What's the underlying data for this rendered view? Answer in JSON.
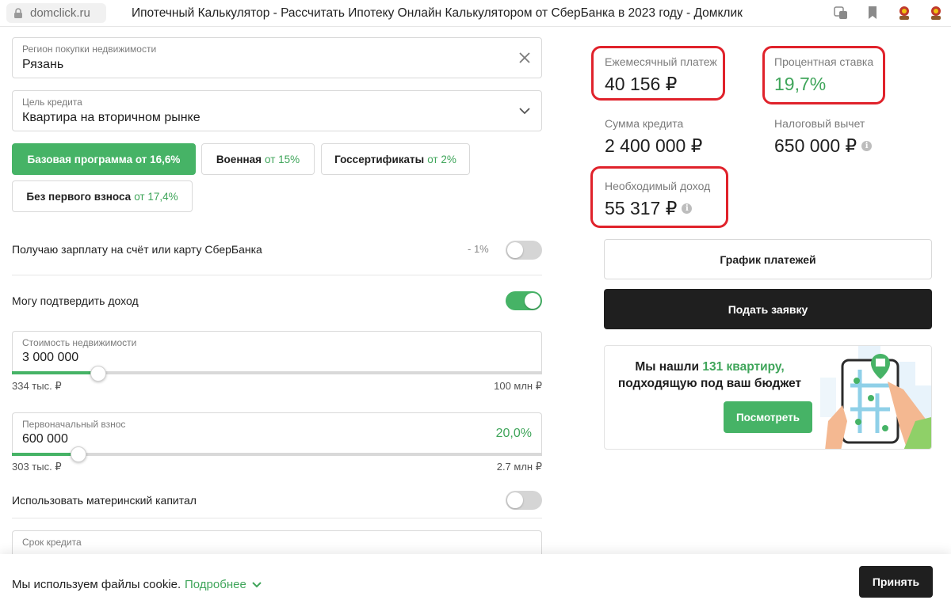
{
  "browser": {
    "url": "domclick.ru",
    "title": "Ипотечный Калькулятор - Рассчитать Ипотеку Онлайн Калькулятором от СберБанка в 2023 году - Домклик",
    "icons": [
      "translate-icon",
      "bookmark-icon",
      "extension-icon",
      "profile-icon"
    ]
  },
  "form": {
    "region": {
      "label": "Регион покупки недвижимости",
      "value": "Рязань"
    },
    "purpose": {
      "label": "Цель кредита",
      "value": "Квартира на вторичном рынке"
    },
    "programs": [
      {
        "name": "Базовая программа от 16,6%",
        "rate": "",
        "active": true
      },
      {
        "name": "Военная",
        "rate": "от 15%",
        "active": false
      },
      {
        "name": "Госсертификаты",
        "rate": "от 2%",
        "active": false
      },
      {
        "name": "Без первого взноса",
        "rate": "от 17,4%",
        "active": false
      }
    ],
    "salary": {
      "label": "Получаю зарплату на счёт или карту СберБанка",
      "discount": "- 1%",
      "on": false
    },
    "income_confirm": {
      "label": "Могу подтвердить доход",
      "on": true
    },
    "price": {
      "label": "Стоимость недвижимости",
      "value": "3 000 000",
      "min": "334 тыс. ₽",
      "max": "100 млн ₽",
      "position": 0.163
    },
    "down_payment": {
      "label": "Первоначальный взнос",
      "value": "600 000",
      "percent": "20,0%",
      "min": "303 тыс. ₽",
      "max": "2.7 млн ₽",
      "position": 0.125
    },
    "mat_capital": {
      "label": "Использовать материнский капитал",
      "on": false
    },
    "term": {
      "label": "Срок кредита"
    }
  },
  "results": {
    "monthly": {
      "label": "Ежемесячный платеж",
      "value": "40 156 ₽"
    },
    "rate": {
      "label": "Процентная ставка",
      "value": "19,7%"
    },
    "loan": {
      "label": "Сумма кредита",
      "value": "2 400 000 ₽"
    },
    "tax": {
      "label": "Налоговый вычет",
      "value": "650 000 ₽"
    },
    "income": {
      "label": "Необходимый доход",
      "value": "55 317 ₽"
    },
    "schedule_button": "График платежей",
    "apply_button": "Подать заявку"
  },
  "promo": {
    "line1_pre": "Мы нашли",
    "line1_hl": "131 квартиру,",
    "line2": "подходящую под ваш бюджет",
    "button": "Посмотреть"
  },
  "cookie": {
    "text": "Мы используем файлы cookie.",
    "more": "Подробнее",
    "accept": "Принять"
  },
  "colors": {
    "accent": "#46b366",
    "highlight_box": "#e0222b",
    "dark_button": "#1f1f1f"
  }
}
